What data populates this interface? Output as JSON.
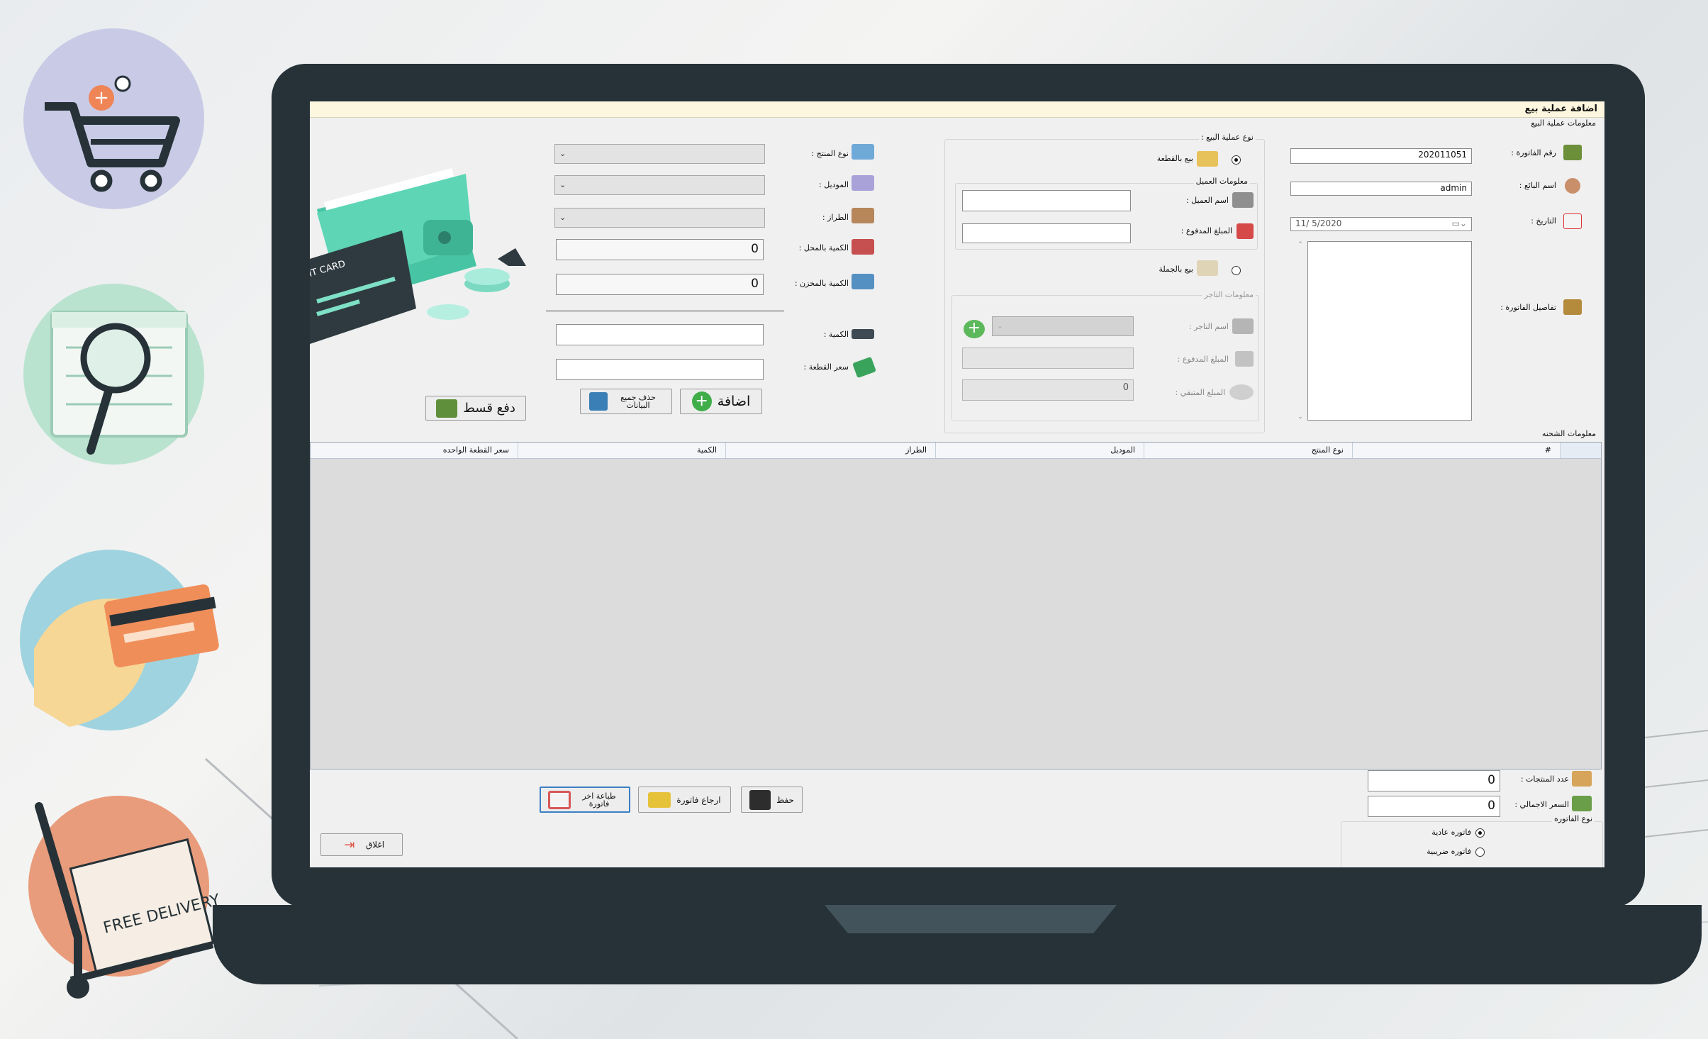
{
  "window": {
    "title": "اضافة عملية بيع"
  },
  "sale_info": {
    "section_title": "معلومات عملية البيع",
    "invoice_no_label": "رقم الفاتورة :",
    "invoice_no": "202011051",
    "seller_label": "اسم البائع :",
    "seller": "admin",
    "date_label": "التاريخ :",
    "date": "11/  5/2020",
    "details_label": "تفاصيل الفاتورة :"
  },
  "sale_type": {
    "title": "نوع عملية البيع :",
    "per_piece": "بيع بالقطعة",
    "wholesale": "بيع بالجملة",
    "customer_info_title": "معلومات العميل",
    "customer_name_label": "اسم العميل :",
    "paid_amount_label": "المبلغ المدفوع :",
    "merchant_info_title": "معلومات التاجر",
    "merchant_name_label": "اسم التاجر :",
    "merchant_paid_label": "المبلغ المدفوع :",
    "remaining_label": "المبلغ المتبقي :",
    "remaining_value": "0"
  },
  "product": {
    "type_label": "نوع المنتج :",
    "model_label": "الموديل :",
    "style_label": "الطراز :",
    "shop_qty_label": "الكمية بالمحل :",
    "shop_qty": "0",
    "store_qty_label": "الكمية بالمخزن :",
    "store_qty": "0",
    "qty_label": "الكمية :",
    "price_label": "سعر القطعة :"
  },
  "buttons": {
    "add": "اضافة",
    "delete_all": "حذف جميع البيانات",
    "installment": "دفع قسط",
    "save": "حفظ",
    "return_invoice": "ارجاع فاتورة",
    "print_last": "طباعة اخر فاتورة",
    "close": "اغلاق"
  },
  "shipment": {
    "title": "معلومات الشحنه",
    "columns": [
      "#",
      "نوع المنتج",
      "الموديل",
      "الطراز",
      "الكمية",
      "سعر القطعة الواحده"
    ]
  },
  "totals": {
    "count_label": "عدد المنتجات :",
    "count": "0",
    "total_label": "السعر الاجمالي :",
    "total": "0",
    "invoice_type_title": "نوع الفاتوره",
    "normal": "فاتوره عادية",
    "tax": "فاتوره ضريبية"
  },
  "decor": {
    "credit_card_text": "IT CARD",
    "free_delivery": "FREE DELIVERY"
  },
  "icons": {
    "cart": "shopping-cart-icon",
    "search": "magnifier-icon",
    "card": "credit-card-icon",
    "delivery": "delivery-box-icon"
  },
  "colors": {
    "laptop": "#263238",
    "title_bar": "#fdf7df",
    "grid": "#dcdcdc",
    "add_green": "#3fae49"
  }
}
